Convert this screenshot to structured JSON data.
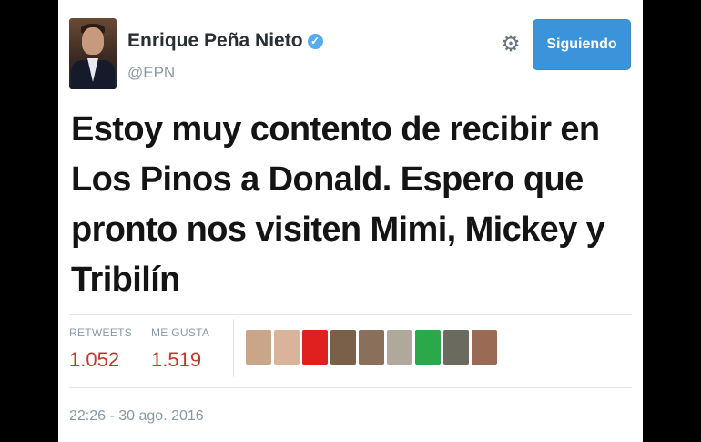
{
  "user": {
    "name": "Enrique Peña Nieto",
    "handle": "@EPN",
    "verified_icon": "verified-badge-icon"
  },
  "actions": {
    "settings_icon": "gear-icon",
    "follow_label": "Siguiendo"
  },
  "tweet": {
    "text": "Estoy muy contento de recibir en Los Pinos a Donald. Espero que pronto nos visiten Mimi, Mickey y Tribilín"
  },
  "stats": {
    "retweets_label": "RETWEETS",
    "retweets_value": "1.052",
    "likes_label": "ME GUSTA",
    "likes_value": "1.519"
  },
  "likers": [
    {
      "color": "#c9a58a"
    },
    {
      "color": "#d9b49a"
    },
    {
      "color": "#e0201f"
    },
    {
      "color": "#7a6048"
    },
    {
      "color": "#8a6f5a"
    },
    {
      "color": "#b0a89c"
    },
    {
      "color": "#2aa84a"
    },
    {
      "color": "#6a6a5e"
    },
    {
      "color": "#9b6a55"
    }
  ],
  "meta": {
    "timestamp": "22:26 - 30 ago. 2016"
  },
  "colors": {
    "follow_button": "#3b94d9",
    "stat_value": "#c0392b",
    "verified": "#55acee"
  }
}
